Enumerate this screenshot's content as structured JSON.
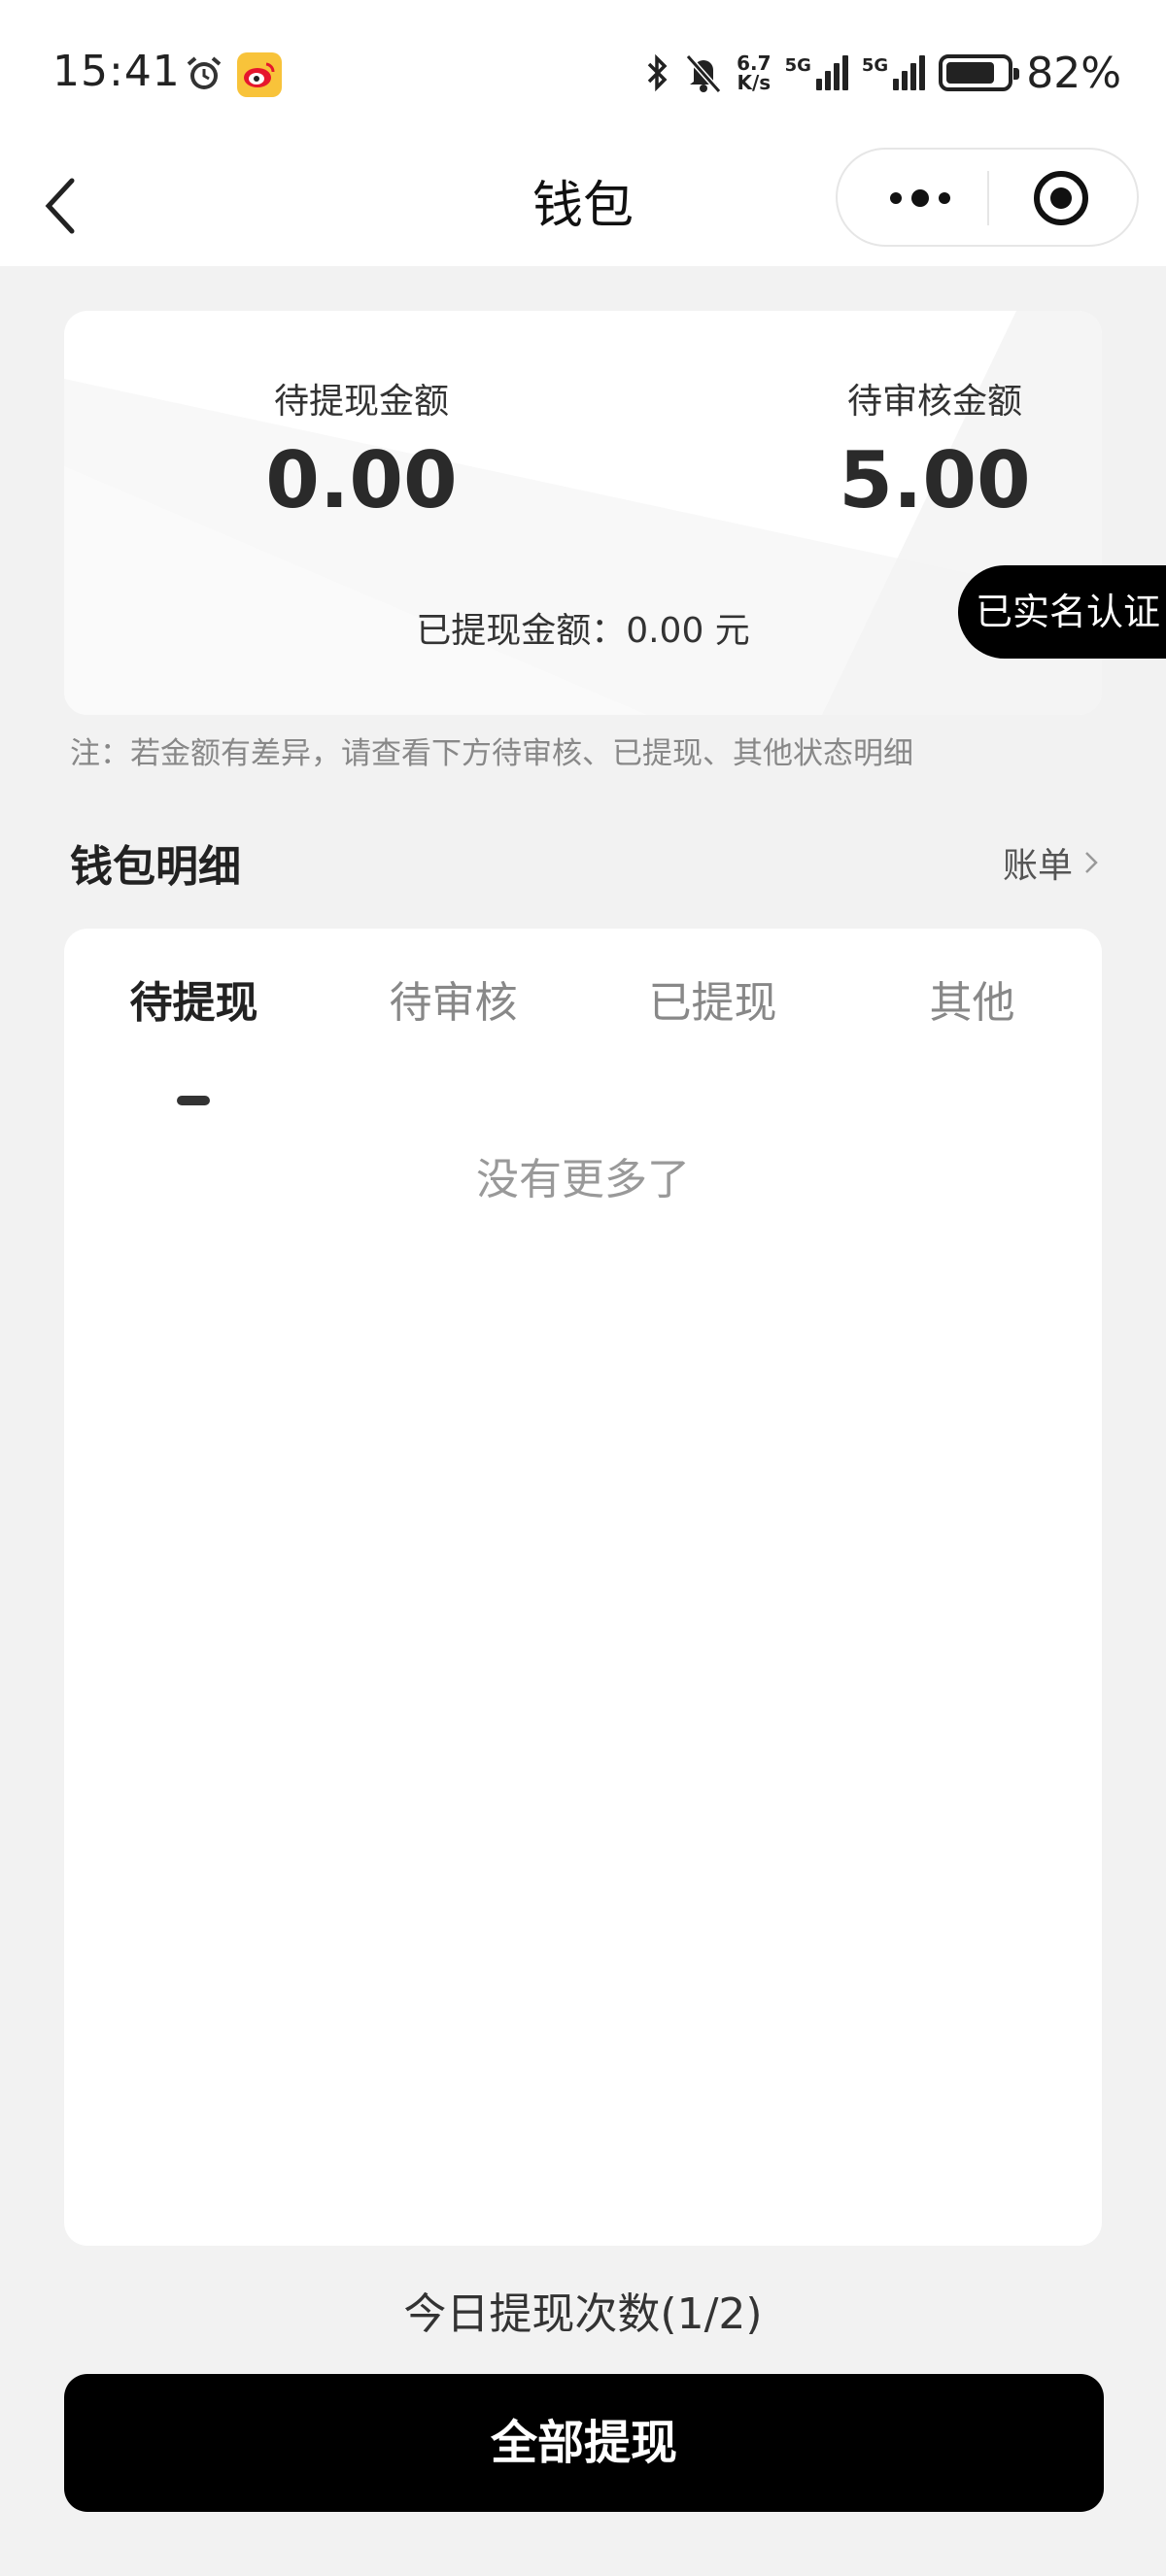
{
  "status_bar": {
    "time": "15:41",
    "net_speed_value": "6.7",
    "net_speed_unit": "K/s",
    "sim1_label": "5G",
    "sim2_label": "5G",
    "battery_percent": "82%",
    "battery_level": 0.82,
    "icons": [
      "alarm-icon",
      "weibo-icon",
      "bluetooth-icon",
      "mute-bell-icon",
      "signal-icon",
      "battery-icon"
    ]
  },
  "nav": {
    "title": "钱包",
    "icons": [
      "back-chevron-icon",
      "more-dots-icon",
      "target-circle-icon"
    ]
  },
  "balance": {
    "pending_withdraw_label": "待提现金额",
    "pending_withdraw_value": "0.00",
    "pending_review_label": "待审核金额",
    "pending_review_value": "5.00",
    "withdrawn_text": "已提现金额：0.00 元"
  },
  "verify_badge": "已实名认证",
  "note": "注：若金额有差异，请查看下方待审核、已提现、其他状态明细",
  "section": {
    "title": "钱包明细",
    "bill_link": "账单"
  },
  "tabs": [
    {
      "label": "待提现",
      "active": true
    },
    {
      "label": "待审核",
      "active": false
    },
    {
      "label": "已提现",
      "active": false
    },
    {
      "label": "其他",
      "active": false
    }
  ],
  "empty_text": "没有更多了",
  "today_count": "今日提现次数(1/2)",
  "withdraw_button": "全部提现",
  "colors": {
    "background": "#f2f2f2",
    "card": "#ffffff",
    "primary_button": "#000000",
    "button_text": "#ffffff",
    "muted_text": "#999999",
    "weibo_badge": "#f8c33a"
  }
}
